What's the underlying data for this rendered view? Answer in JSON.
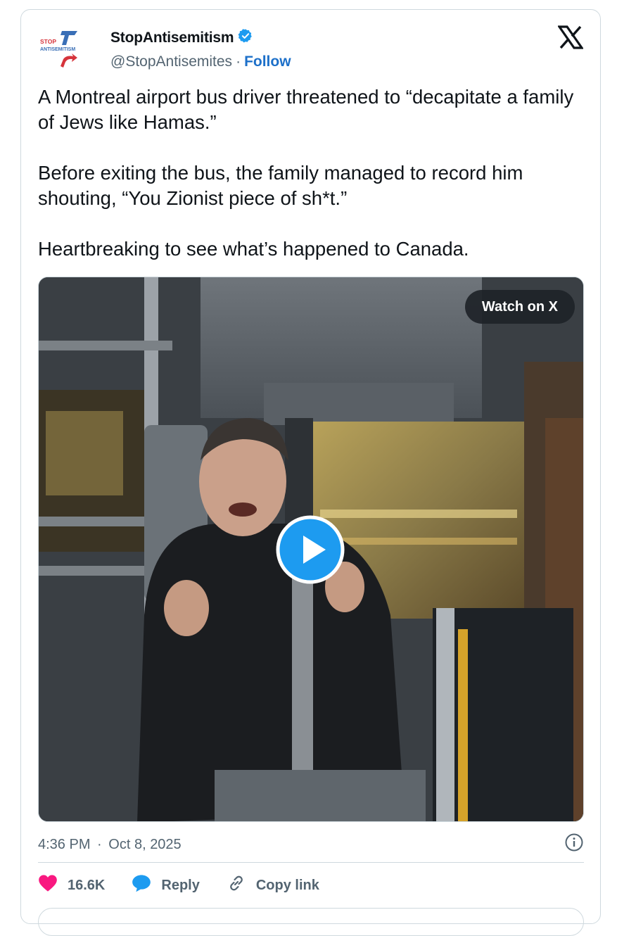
{
  "author": {
    "display_name": "StopAntisemitism",
    "handle": "@StopAntisemites",
    "separator": "·",
    "follow_label": "Follow",
    "verified": true,
    "logo_text_top": "STOP",
    "logo_text_bottom": "ANTISEMITISM"
  },
  "tweet": {
    "paragraphs": [
      "A Montreal airport bus driver threatened to “decapitate a family of Jews like Hamas.”",
      "Before exiting the bus, the family managed to record him shouting, “You Zionist piece of sh*t.”",
      "Heartbreaking to see what’s happened to Canada."
    ]
  },
  "media": {
    "type": "video",
    "watch_label": "Watch on X"
  },
  "meta": {
    "time": "4:36 PM",
    "separator": "·",
    "date": "Oct 8, 2025"
  },
  "actions": {
    "likes_count": "16.6K",
    "reply_label": "Reply",
    "copy_link_label": "Copy link"
  },
  "colors": {
    "accent": "#1d9bf0",
    "follow": "#1d70c9",
    "like": "#f91880",
    "muted": "#536471",
    "border": "#cfd9de",
    "logo_blue": "#3a6fb6",
    "logo_red": "#d6343b"
  },
  "icons": {
    "verified": "verified-badge-icon",
    "x": "x-logo-icon",
    "info": "info-icon",
    "like": "heart-icon",
    "reply": "speech-bubble-icon",
    "copy_link": "link-icon",
    "play": "play-icon"
  }
}
